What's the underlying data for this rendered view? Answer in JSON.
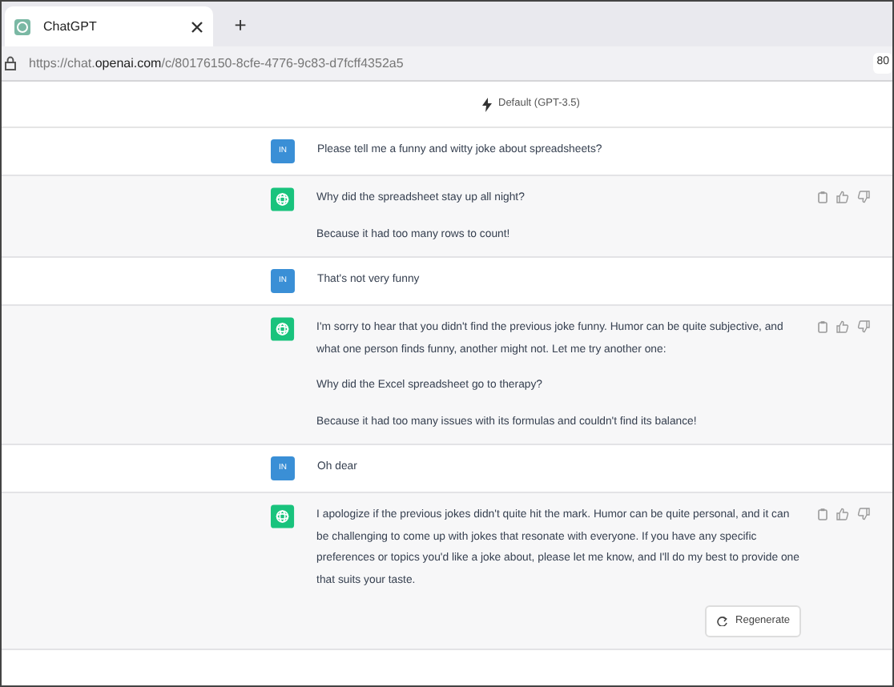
{
  "browser": {
    "tab": {
      "title": "ChatGPT",
      "selected": true
    },
    "new_tab": "+",
    "url": {
      "prefix": "https://chat.",
      "domain": "openai.com",
      "path": "/c/80176150-8cfe-4776-9c83-d7fcff4352a5"
    },
    "zoom": "80"
  },
  "model": "Default (GPT-3.5)",
  "messages": [
    {
      "kind": "user",
      "avatar": "IN",
      "paragraphs": [
        "Please tell me a funny and witty joke about spreadsheets?"
      ]
    },
    {
      "kind": "assistant",
      "paragraphs": [
        "Why did the spreadsheet stay up all night?",
        "Because it had too many rows to count!"
      ]
    },
    {
      "kind": "user",
      "avatar": "IN",
      "paragraphs": [
        "That's not very funny"
      ]
    },
    {
      "kind": "assistant",
      "paragraphs": [
        "I'm sorry to hear that you didn't find the previous joke funny. Humor can be quite subjective, and what one person finds funny, another might not. Let me try another one:",
        "Why did the Excel spreadsheet go to therapy?",
        "Because it had too many issues with its formulas and couldn't find its balance!"
      ]
    },
    {
      "kind": "user",
      "avatar": "IN",
      "paragraphs": [
        "Oh dear"
      ]
    },
    {
      "kind": "assistant",
      "paragraphs": [
        "I apologize if the previous jokes didn't quite hit the mark. Humor can be quite personal, and it can be challenging to come up with jokes that resonate with everyone. If you have any specific preferences or topics you'd like a joke about, please let me know, and I'll do my best to provide one that suits your taste."
      ]
    }
  ],
  "regenerate": "Regenerate"
}
